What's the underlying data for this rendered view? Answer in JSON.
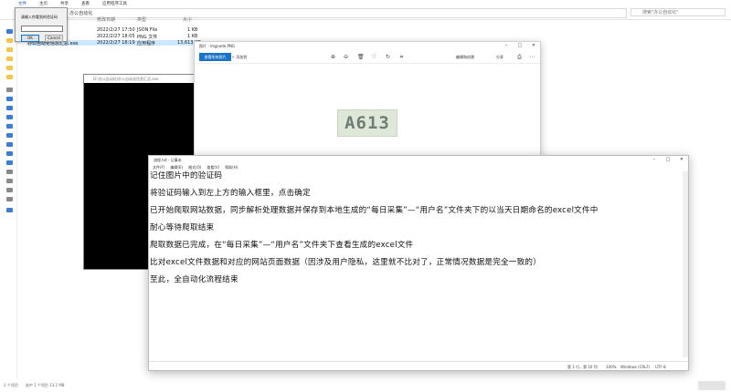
{
  "explorer": {
    "ribbon_tabs": [
      "文件",
      "主页",
      "共享",
      "查看",
      "应用程序工具"
    ],
    "address": "自动化 (D:) › 办公自动化",
    "search_placeholder": "搜索\"办公自动化\"",
    "columns": {
      "modified": "修改日期",
      "type": "类型",
      "size": "大小"
    },
    "files": [
      {
        "date": "2022/2/27 17:50",
        "type": "JSON File",
        "size": "1 KB"
      },
      {
        "date": "2022/2/27 18:05",
        "type": "PNG 文件",
        "size": "1 KB"
      },
      {
        "name": "办公自动化信息汇总.exe",
        "date": "2022/2/27 18:19",
        "type": "应用程序",
        "size": "13,613 KB"
      }
    ],
    "status": "3 个项目　　选中 1 个项目 13.2 MB"
  },
  "dialog": {
    "prompt": "请输入你看到的验证码",
    "ok_label": "OK",
    "cancel_label": "Cancel"
  },
  "console": {
    "title": "D:\\办公自动化\\办公自动化信息汇总.exe"
  },
  "photos": {
    "title": "照片 - imgcode.PNG",
    "see_all_label": "查看所有照片",
    "add_label": "添加到",
    "edit_label": "编辑和创建",
    "share_label": "分享",
    "captcha_text": "A613"
  },
  "notepad": {
    "title": "流程.txt - 记事本",
    "menu": [
      "文件(F)",
      "编辑(E)",
      "格式(O)",
      "查看(V)",
      "帮助(H)"
    ],
    "lines": [
      "记住图片中的验证码",
      "将验证码输入到左上方的输入框里，点击确定",
      "已开始爬取网站数据，同步解析处理数据并保存到本地生成的“每日采集”—“用户名”文件夹下的以当天日期命名的excel文件中",
      "耐心等待爬取结束",
      "爬取数据已完成，在“每日采集”—“用户名”文件夹下查看生成的excel文件",
      "比对excel文件数据和对应的网站页面数据（因涉及用户隐私，这里就不比对了，正常情况数据是完全一致的）",
      "至此，全自动化流程结束"
    ],
    "status": {
      "position": "第 1 行，第 10 列",
      "zoom": "100%",
      "eol": "Windows (CRLF)",
      "encoding": "UTF-8"
    }
  }
}
